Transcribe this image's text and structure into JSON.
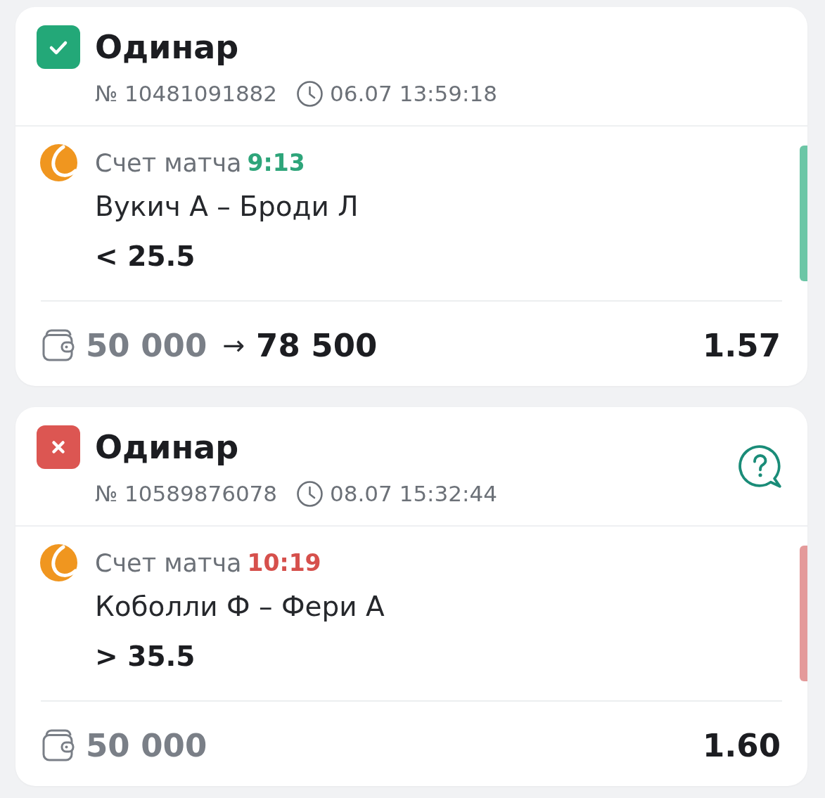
{
  "bets": [
    {
      "kind": "won",
      "title": "Одинар",
      "number": "№ 10481091882",
      "datetime": "06.07 13:59:18",
      "help": false,
      "event": {
        "score_label": "Счет матча",
        "score": "9:13",
        "teams": "Вукич А – Броди Л",
        "outcome": "< 25.5"
      },
      "stake": "50 000",
      "arrow": "→",
      "payout": "78 500",
      "odds": "1.57"
    },
    {
      "kind": "lost",
      "title": "Одинар",
      "number": "№ 10589876078",
      "datetime": "08.07 15:32:44",
      "help": true,
      "event": {
        "score_label": "Счет матча",
        "score": "10:19",
        "teams": "Коболли Ф – Фери А",
        "outcome": "> 35.5"
      },
      "stake": "50 000",
      "odds": "1.60"
    }
  ]
}
